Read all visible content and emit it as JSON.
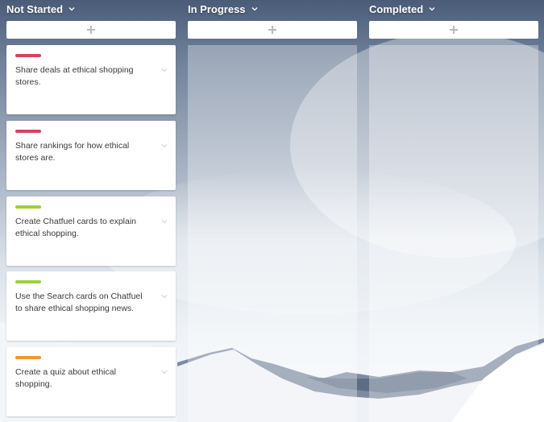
{
  "board": {
    "columns": [
      {
        "title": "Not Started",
        "cards": [
          {
            "text": "Share deals at ethical shopping stores.",
            "tag_color": "#d9415f"
          },
          {
            "text": "Share rankings for how ethical stores are.",
            "tag_color": "#d9415f"
          },
          {
            "text": "Create Chatfuel cards to explain ethical shopping.",
            "tag_color": "#9fce3d"
          },
          {
            "text": "Use the Search cards on Chatfuel to share ethical shopping news.",
            "tag_color": "#9fce3d"
          },
          {
            "text": "Create a quiz about ethical shopping.",
            "tag_color": "#f0982f"
          }
        ]
      },
      {
        "title": "In Progress",
        "cards": []
      },
      {
        "title": "Completed",
        "cards": []
      }
    ]
  },
  "icons": {
    "column_menu": "chevron-down-icon",
    "add": "plus-icon",
    "card_menu": "chevron-down-icon"
  }
}
